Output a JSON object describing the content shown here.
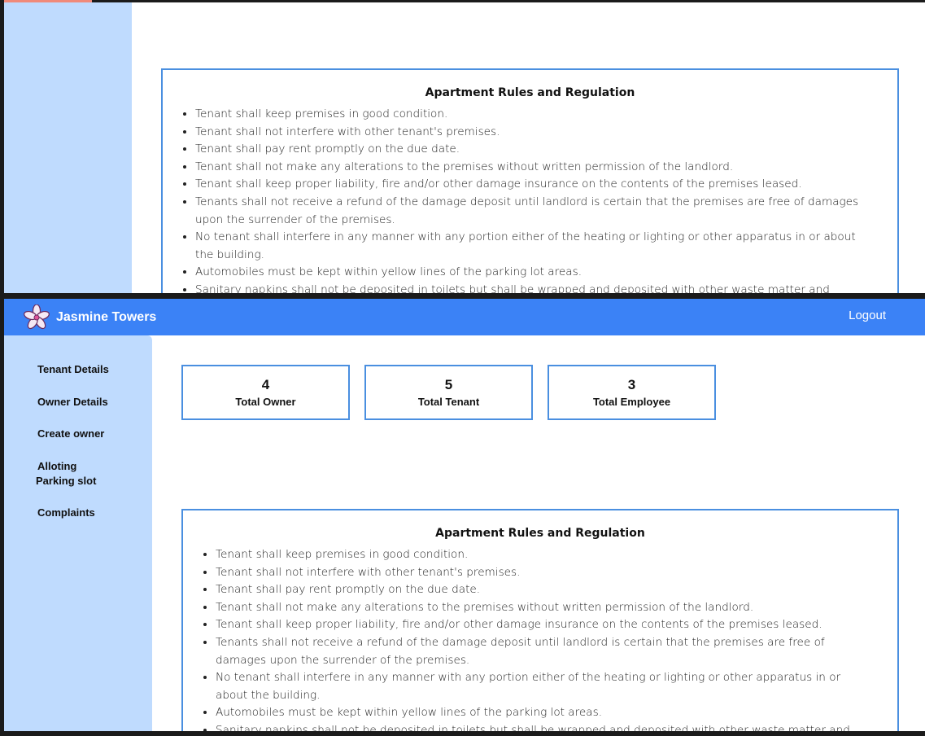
{
  "brand": {
    "name": "Jasmine Towers",
    "logo_icon": "jasmine-flower-icon"
  },
  "navbar": {
    "logout_label": "Logout"
  },
  "sidebar": {
    "items": [
      {
        "label": "Tenant Details"
      },
      {
        "label": "Owner Details"
      },
      {
        "label": "Create owner"
      },
      {
        "label_line1": "Alloting",
        "label_line2": "Parking slot"
      },
      {
        "label": "Complaints"
      }
    ]
  },
  "stats": [
    {
      "value": "4",
      "label": "Total Owner"
    },
    {
      "value": "5",
      "label": "Total Tenant"
    },
    {
      "value": "3",
      "label": "Total Employee"
    }
  ],
  "rules": {
    "title": "Apartment Rules and Regulation",
    "items": [
      "Tenant shall keep premises in good condition.",
      "Tenant shall not interfere with other tenant's premises.",
      "Tenant shall pay rent promptly on the due date.",
      "Tenant shall not make any alterations to the premises without written permission of the landlord.",
      "Tenant shall keep proper liability, fire and/or other damage insurance on the contents of the premises leased.",
      "Tenants shall not receive a refund of the damage deposit until landlord is certain that the premises are free of damages upon the surrender of the premises.",
      "No tenant shall interfere in any manner with any portion either of the heating or lighting or other apparatus in or about the building.",
      "Automobiles must be kept within yellow lines of the parking lot areas.",
      "Sanitary napkins shall not be deposited in toilets but shall be wrapped and deposited with other waste matter and"
    ]
  },
  "colors": {
    "navbar": "#3b82f6",
    "sidebar": "#bfdbfe",
    "card_border": "#4a8fe0"
  }
}
